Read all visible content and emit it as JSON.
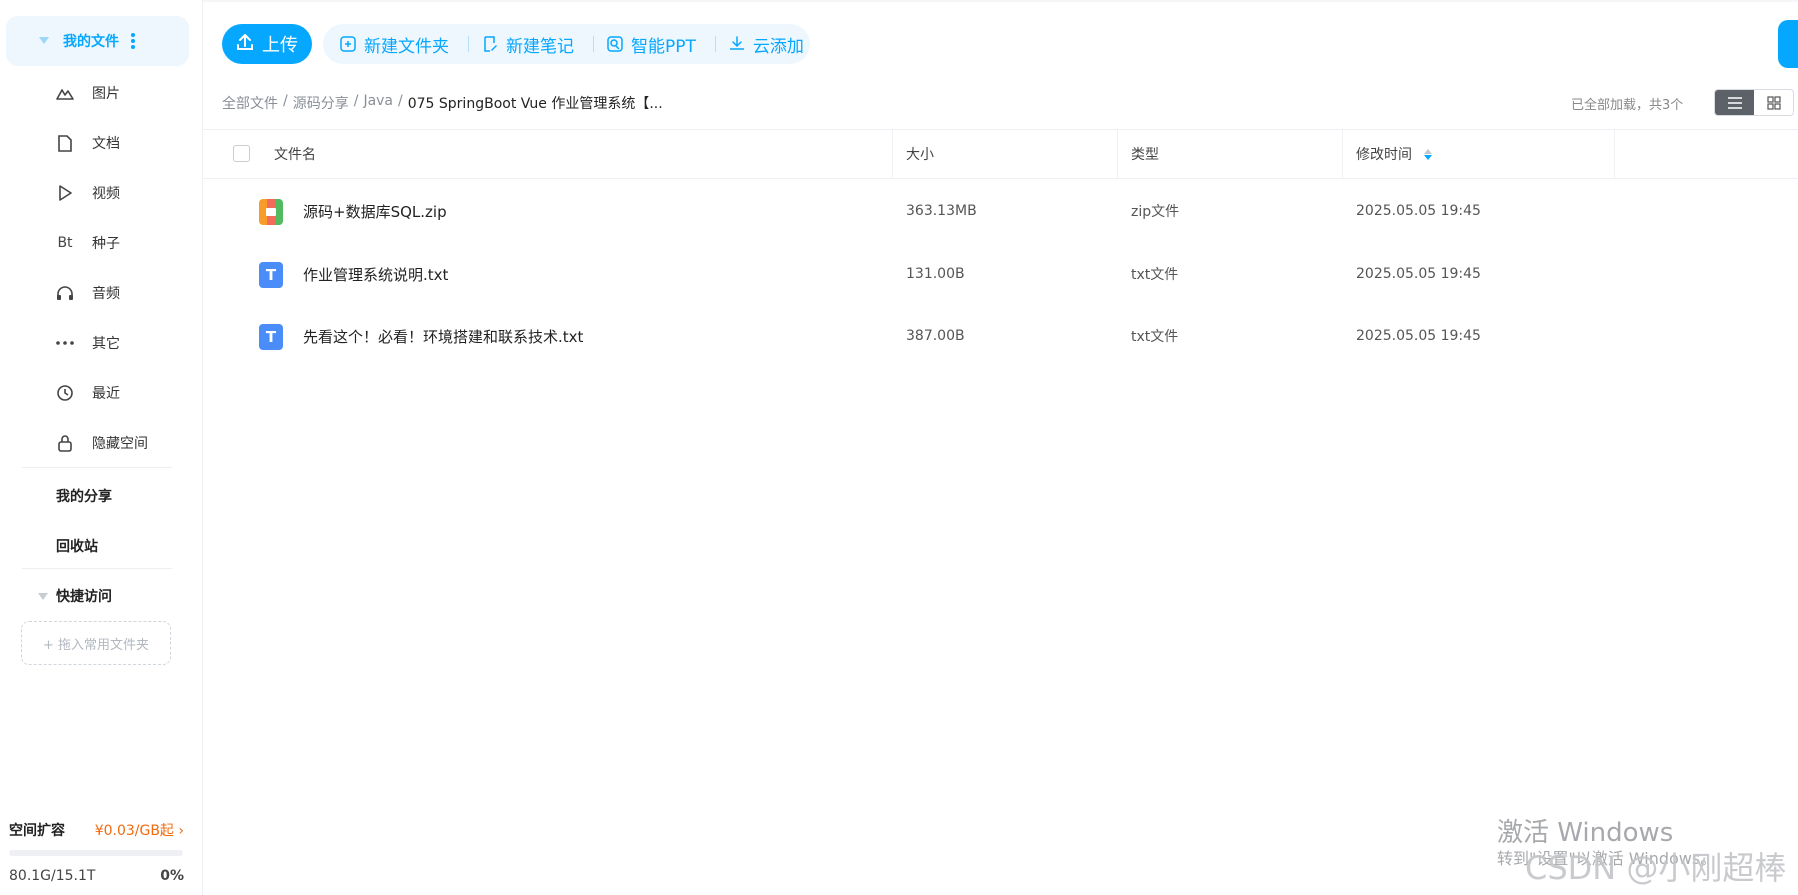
{
  "sidebar": {
    "my_files": "我的文件",
    "items": [
      {
        "label": "图片",
        "icon": "image-icon"
      },
      {
        "label": "文档",
        "icon": "document-icon"
      },
      {
        "label": "视频",
        "icon": "video-icon"
      },
      {
        "label": "种子",
        "icon": "torrent-icon",
        "icon_text": "Bt"
      },
      {
        "label": "音频",
        "icon": "headphones-icon"
      },
      {
        "label": "其它",
        "icon": "more-icon"
      },
      {
        "label": "最近",
        "icon": "history-icon"
      },
      {
        "label": "隐藏空间",
        "icon": "lock-icon"
      }
    ],
    "my_share": "我的分享",
    "recycle_bin": "回收站",
    "quick_access": "快捷访问",
    "drop_folder": "+ 拖入常用文件夹",
    "expand_title": "空间扩容",
    "expand_price": "¥0.03/GB起",
    "usage": "80.1G/15.1T",
    "usage_percent": "0%"
  },
  "toolbar": {
    "upload": "上传",
    "new_folder": "新建文件夹",
    "new_note": "新建笔记",
    "smart_ppt": "智能PPT",
    "cloud_add": "云添加"
  },
  "breadcrumb": [
    "全部文件",
    "源码分享",
    "Java",
    "075 SpringBoot Vue 作业管理系统【..."
  ],
  "load_status": "已全部加载，共3个",
  "view_mode": "list",
  "table": {
    "headers": {
      "name": "文件名",
      "size": "大小",
      "type": "类型",
      "modified": "修改时间"
    },
    "rows": [
      {
        "name": "源码+数据库SQL.zip",
        "size": "363.13MB",
        "type": "zip文件",
        "modified": "2025.05.05 19:45",
        "icon": "zip-file-icon"
      },
      {
        "name": "作业管理系统说明.txt",
        "size": "131.00B",
        "type": "txt文件",
        "modified": "2025.05.05 19:45",
        "icon": "txt-file-icon"
      },
      {
        "name": "先看这个！必看！环境搭建和联系技术.txt",
        "size": "387.00B",
        "type": "txt文件",
        "modified": "2025.05.05 19:45",
        "icon": "txt-file-icon"
      }
    ]
  },
  "watermark": {
    "activate_title": "激活 Windows",
    "activate_sub": "转到\"设置\"以激活 Windows。",
    "csdn": "CSDN @小刚超棒"
  },
  "colors": {
    "accent": "#06a7ff",
    "price": "#f06a10"
  }
}
